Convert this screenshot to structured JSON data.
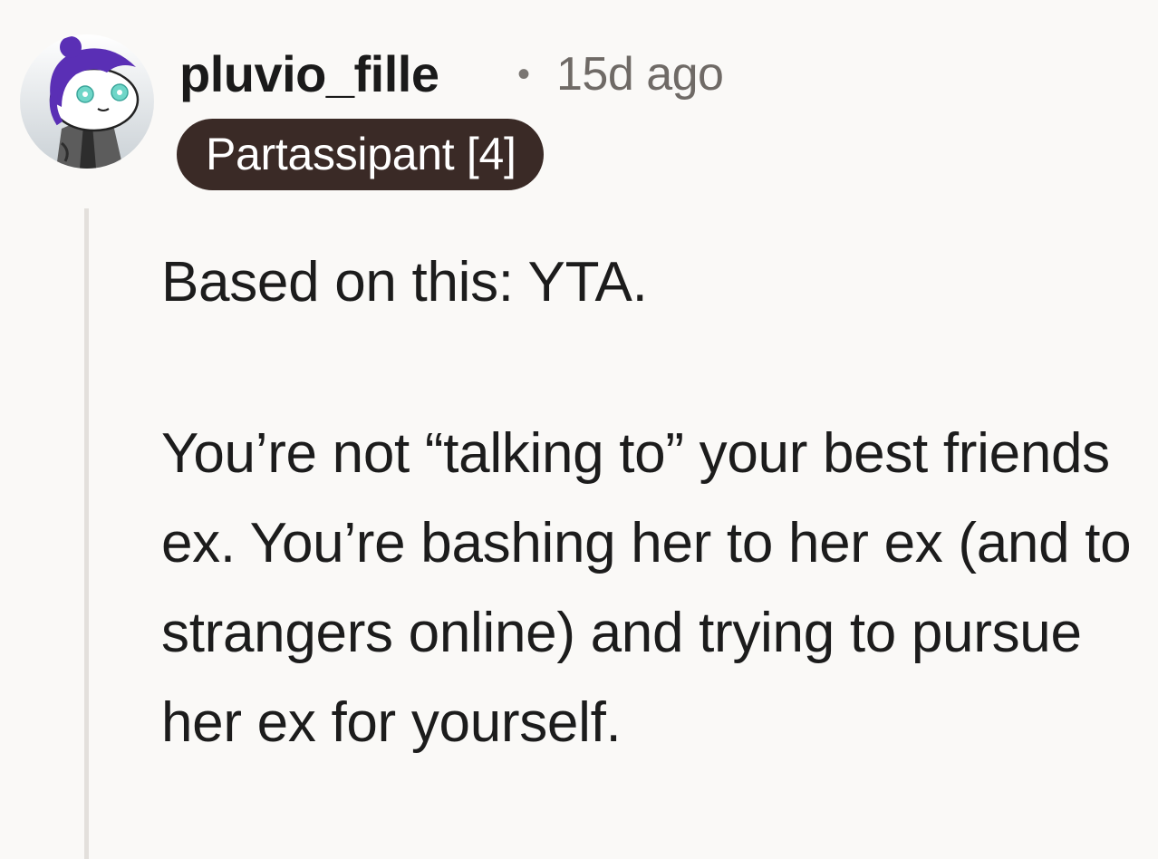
{
  "comment": {
    "author": "pluvio_fille",
    "separator": "•",
    "age": "15d ago",
    "flair": "Partassipant [4]",
    "paragraphs": [
      "Based on this: YTA.",
      "You’re not “talking to” your best friends ex. You’re bashing her to her ex (and to strangers online) and trying to pursue her ex for yourself."
    ]
  },
  "avatar": {
    "icon": "snoo-avatar-icon",
    "colors": {
      "background": "#d9dde0",
      "hair": "#5a2fb5",
      "eyes": "#6fd6c8",
      "jacket": "#595959"
    }
  },
  "colors": {
    "page_background": "#faf9f7",
    "flair_background": "#3a2a26",
    "flair_text": "#ffffff",
    "timestamp": "#6f6a66",
    "thread_line": "#e3e0dc"
  }
}
